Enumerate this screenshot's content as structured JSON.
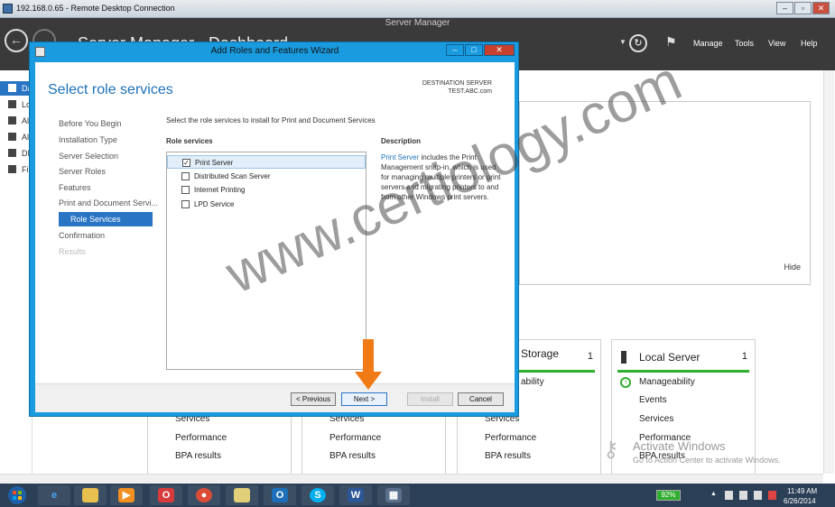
{
  "rdp": {
    "title": "192.168.0.65 - Remote Desktop Connection",
    "min": "–",
    "restore": "▫",
    "close": "✕"
  },
  "server_manager": {
    "title": "Server Manager",
    "breadcrumb_fragment": "Server Manager · Dashboard",
    "menu": [
      "Manage",
      "Tools",
      "View",
      "Help"
    ],
    "nav": [
      "Da",
      "Lo",
      "Al",
      "Al",
      "DI",
      "Fi"
    ],
    "hide_label": "Hide"
  },
  "tiles": [
    {
      "head": "",
      "count": "",
      "items": [
        "Services",
        "Performance",
        "BPA results"
      ]
    },
    {
      "head": "",
      "count": "",
      "items": [
        "Services",
        "Performance",
        "BPA results"
      ]
    },
    {
      "head": "Storage",
      "count": "1",
      "items": [
        "ability",
        "Services",
        "Performance",
        "BPA results"
      ]
    },
    {
      "head": "Local Server",
      "count": "1",
      "items": [
        "Manageability",
        "Events",
        "Services",
        "Performance",
        "BPA results"
      ]
    }
  ],
  "activate": {
    "title": "Activate Windows",
    "subtitle": "Go to Action Center to activate Windows."
  },
  "wizard": {
    "title": "Add Roles and Features Wizard",
    "heading": "Select role services",
    "destination_label": "DESTINATION SERVER",
    "destination_value": "TEST.ABC.com",
    "steps": [
      "Before You Begin",
      "Installation Type",
      "Server Selection",
      "Server Roles",
      "Features",
      "Print and Document Servi...",
      "Role Services",
      "Confirmation",
      "Results"
    ],
    "intro": "Select the role services to install for Print and Document Services",
    "role_services_header": "Role services",
    "description_header": "Description",
    "role_services": [
      {
        "label": "Print Server",
        "checked": true
      },
      {
        "label": "Distributed Scan Server",
        "checked": false
      },
      {
        "label": "Internet Printing",
        "checked": false
      },
      {
        "label": "LPD Service",
        "checked": false
      }
    ],
    "description_link": "Print Server",
    "description_text": " includes the Print Management snap-in, which is used for managing multiple printers or print servers and migrating printers to and from other Windows print servers.",
    "buttons": {
      "previous": "< Previous",
      "next": "Next >",
      "install": "Install",
      "cancel": "Cancel"
    }
  },
  "watermark": "www.certiology.com",
  "taskbar": {
    "battery": "92%",
    "time": "11:49 AM",
    "date": "6/26/2014",
    "apps": [
      "internet-explorer",
      "file-explorer",
      "media-player",
      "office-app",
      "chrome",
      "folder",
      "outlook",
      "skype",
      "word",
      "server-manager"
    ]
  }
}
